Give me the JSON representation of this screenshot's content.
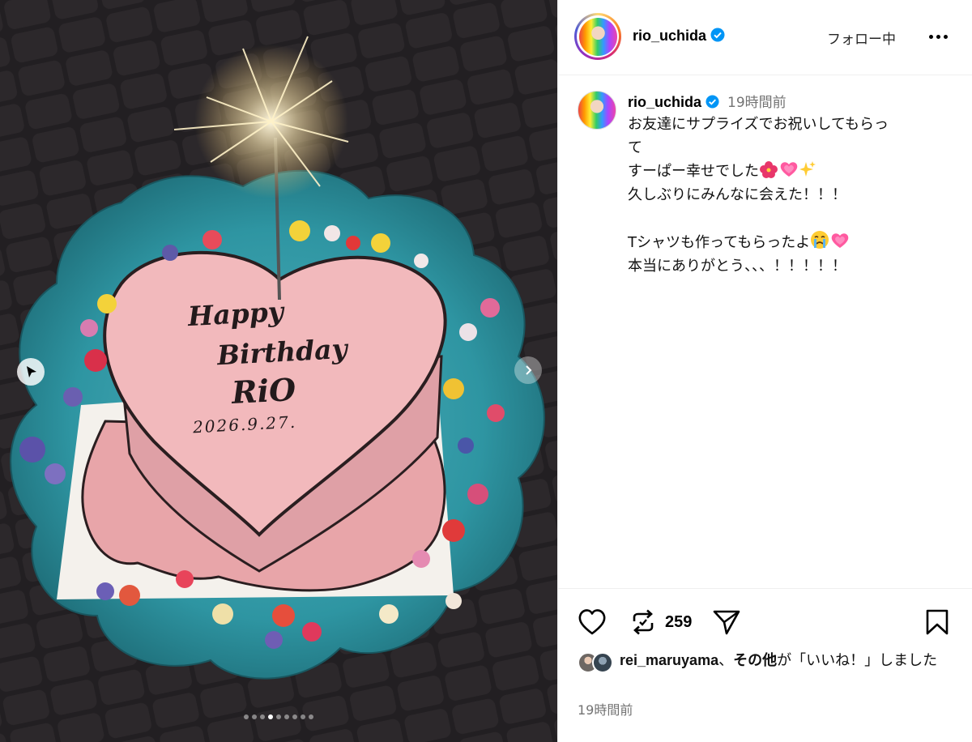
{
  "post": {
    "username": "rio_uchida",
    "follow_label": "フォロー中",
    "time_ago": "19時間前",
    "caption_lines": [
      "お友達にサプライズでお祝いしてもらって",
      "すーぱー幸せでした",
      "久しぶりにみんなに会えた！！！",
      "",
      "Tシャツも作ってもらったよ",
      "本当にありがとう、、、！！！！！"
    ],
    "repost_count": "259",
    "likes": {
      "first_user": "rei_maruyama",
      "separator": "、",
      "others": "その他",
      "suffix": "が「いいね！」しました"
    },
    "footer_time": "19時間前"
  },
  "photo": {
    "cake_lines": [
      "Happy",
      "Birthday",
      "RiO",
      "2026.9.27."
    ],
    "slide_count": 9,
    "active_slide": 3
  },
  "icons": {
    "verified": "verified-badge-icon",
    "more": "more-options-icon",
    "like": "heart-icon",
    "repost": "repost-icon",
    "share": "send-icon",
    "save": "bookmark-icon",
    "prev": "chevron-left-icon",
    "next": "chevron-right-icon"
  },
  "colors": {
    "verified": "#0095f6",
    "secondary_text": "#737373",
    "divider": "#efefef"
  }
}
